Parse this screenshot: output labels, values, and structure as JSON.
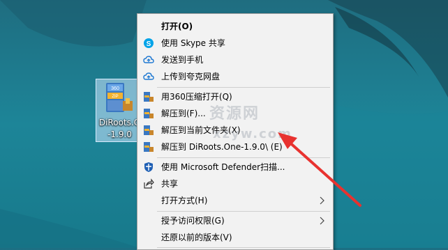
{
  "desktop_icon": {
    "name_line1": "DiRoots.O",
    "name_line2": "-1.9.0",
    "icon_name": "winrar-archive-icon"
  },
  "context_menu": {
    "items": [
      {
        "label": "打开(O)",
        "icon": "none",
        "bold": true
      },
      {
        "label": "使用 Skype 共享",
        "icon": "skype-icon"
      },
      {
        "label": "发送到手机",
        "icon": "cloud-upload-icon"
      },
      {
        "label": "上传到夸克网盘",
        "icon": "cloud-upload-icon"
      },
      {
        "label": "用360压缩打开(Q)",
        "icon": "archive-icon"
      },
      {
        "label": "解压到(F)...",
        "icon": "archive-icon"
      },
      {
        "label": "解压到当前文件夹(X)",
        "icon": "archive-icon"
      },
      {
        "label": "解压到 DiRoots.One-1.9.0\\ (E)",
        "icon": "archive-icon"
      },
      {
        "label": "使用 Microsoft Defender扫描...",
        "icon": "defender-shield-icon"
      },
      {
        "label": "共享",
        "icon": "share-icon"
      },
      {
        "label": "打开方式(H)",
        "icon": "none",
        "submenu": true
      },
      {
        "label": "授予访问权限(G)",
        "icon": "none",
        "submenu": true
      },
      {
        "label": "还原以前的版本(V)",
        "icon": "none"
      }
    ]
  },
  "watermark": {
    "line1": "资源网",
    "line2": "xzyw.com"
  },
  "colors": {
    "annotation_arrow": "#e8322f",
    "menu_background": "#f2f2f2"
  }
}
